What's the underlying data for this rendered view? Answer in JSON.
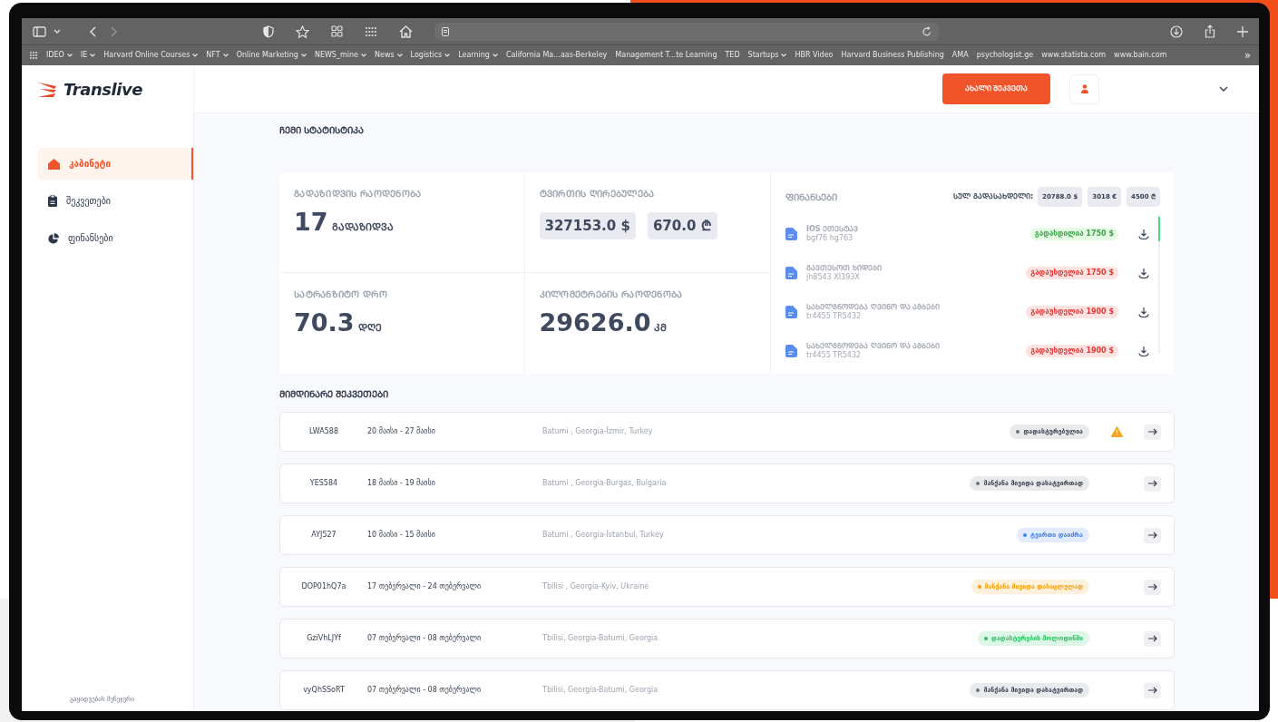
{
  "browser": {
    "bookmarks": [
      {
        "label": "IDEO",
        "menu": true
      },
      {
        "label": "IE",
        "menu": true
      },
      {
        "label": "Harvard Online Courses",
        "menu": true
      },
      {
        "label": "NFT",
        "menu": true
      },
      {
        "label": "Online Marketing",
        "menu": true
      },
      {
        "label": "NEWS_mine",
        "menu": true
      },
      {
        "label": "News",
        "menu": true
      },
      {
        "label": "Logistics",
        "menu": true
      },
      {
        "label": "Learning",
        "menu": true
      },
      {
        "label": "California Ma...aas-Berkeley",
        "menu": false
      },
      {
        "label": "Management T...te Learning",
        "menu": false
      },
      {
        "label": "TED",
        "menu": false
      },
      {
        "label": "Startups",
        "menu": true
      },
      {
        "label": "HBR Video",
        "menu": false
      },
      {
        "label": "Harvard Business Publishing",
        "menu": false
      },
      {
        "label": "AMA",
        "menu": false
      },
      {
        "label": "psychologist.ge",
        "menu": false
      },
      {
        "label": "www.statista.com",
        "menu": false
      },
      {
        "label": "www.bain.com",
        "menu": false
      }
    ],
    "more": "»"
  },
  "logo": "Translive",
  "sidebar": {
    "items": [
      {
        "label": "კაბინეტი",
        "selected": true
      },
      {
        "label": "შეკვეთები",
        "selected": false
      },
      {
        "label": "ფინანსები",
        "selected": false
      }
    ],
    "footer": "გაყიდვების მენეჯერი"
  },
  "header": {
    "new_order": "ᲐᲮᲐᲚᲘ ᲨᲔᲙᲕᲔᲗᲐ"
  },
  "stats": {
    "title": "ᲩᲔᲛᲘ ᲡᲢᲐᲢᲘᲡᲢᲘᲙᲐ",
    "cards": [
      {
        "kind": "value",
        "label": "ᲒᲐᲓᲐᲖᲘᲓᲕᲘᲡ ᲠᲐᲝᲓᲔᲜᲝᲑᲐ",
        "value": "17",
        "unit": "ᲒᲐᲓᲐᲖᲘᲓᲕᲐ"
      },
      {
        "kind": "chips",
        "label": "ᲢᲕᲘᲠᲗᲘᲡ ᲦᲘᲠᲔᲑᲣᲚᲔᲑᲐ",
        "chips": [
          "327153.0 $",
          "670.0 ₾"
        ]
      },
      {
        "kind": "value",
        "label": "ᲡᲐᲢᲠᲐᲜᲖᲘᲢᲝ ᲓᲠᲝ",
        "value": "70.3",
        "unit": "ᲓᲦᲔ"
      },
      {
        "kind": "value",
        "label": "ᲙᲘᲚᲝᲛᲔᲢᲠᲔᲑᲘᲡ ᲠᲐᲝᲓᲔᲜᲝᲑᲐ",
        "value": "29626.0",
        "unit": "ᲙᲛ"
      }
    ]
  },
  "finances": {
    "title": "ᲤᲘᲜᲐᲜᲡᲔᲑᲘ",
    "total_label": "ᲡᲣᲚ ᲒᲐᲓᲐᲡᲐᲮᲓᲔᲚᲘ:",
    "totals": [
      "20788.0 $",
      "3018 €",
      "4500 ₾"
    ],
    "items": [
      {
        "name": "IOS ᲔᲗᲔᲡᲢᲐᲕ",
        "code": "bgf76 hg763",
        "status": "გადახდილია 1750 $",
        "paid": true
      },
      {
        "name": "ᲒᲐᲕᲗᲔᲡᲝᲗ ᲮᲘᲓᲔᲑᲘ",
        "code": "jh8543 XI393X",
        "status": "გადაუხდელია 1750 $",
        "paid": false
      },
      {
        "name": "ᲡᲐᲮᲔᲚᲒᲜᲝᲓᲔᲑᲐ ᲦᲕᲘᲜᲝ ᲓᲐ ᲐᲛᲑᲔᲑᲘ",
        "code": "tr4455 TR5432",
        "status": "გადაუხდელია 1900 $",
        "paid": false
      },
      {
        "name": "ᲡᲐᲮᲔᲚᲒᲜᲝᲓᲔᲑᲐ ᲦᲕᲘᲜᲝ ᲓᲐ ᲐᲛᲑᲔᲑᲘ",
        "code": "tr4455 TR5432",
        "status": "გადაუხდელია 1900 $",
        "paid": false
      }
    ]
  },
  "orders": {
    "title": "ᲛᲘᲛᲓᲘᲜᲐᲠᲔ ᲨᲔᲙᲕᲔᲗᲔᲑᲘ",
    "rows": [
      {
        "id": "LWA588",
        "dates": "20 მაისი - 27 მაისი",
        "route": "Batumi , Georgia-İzmir, Turkey",
        "status": "დადასტურებულია",
        "color": "#6b7280",
        "warning": true
      },
      {
        "id": "YES584",
        "dates": "18 მაისი - 19 მაისი",
        "route": "Batumi , Georgia-Burgas, Bulgaria",
        "status": "მანქანა მივიდა დასატვირთად",
        "color": "#6b7280",
        "warning": false
      },
      {
        "id": "AYJ527",
        "dates": "10 მაისი - 15 მაისი",
        "route": "Batumi , Georgia-İstanbul, Turkey",
        "status": "ტვირთი დაიძრა",
        "color": "#3b82f6",
        "warning": false
      },
      {
        "id": "DOP01hQ7a",
        "dates": "17 თებერვალი - 24 თებერვალი",
        "route": "Tbilisi , Georgia-Kyiv, Ukraine",
        "status": "მანქანა მივიდა დასაცლელად",
        "color": "#f59e0b",
        "warning": false
      },
      {
        "id": "GziVhLJYf",
        "dates": "07 თებერვალი - 08 თებერვალი",
        "route": "Tbilisi, Georgia-Batumi, Georgia",
        "status": "დადასტურების მოლოდინში",
        "color": "#22c55e",
        "warning": false
      },
      {
        "id": "vyQhSSoRT",
        "dates": "07 თებერვალი - 08 თებერვალი",
        "route": "Tbilisi, Georgia-Batumi, Georgia",
        "status": "მანქანა მივიდა დასატვირთად",
        "color": "#6b7280",
        "warning": false
      }
    ]
  }
}
